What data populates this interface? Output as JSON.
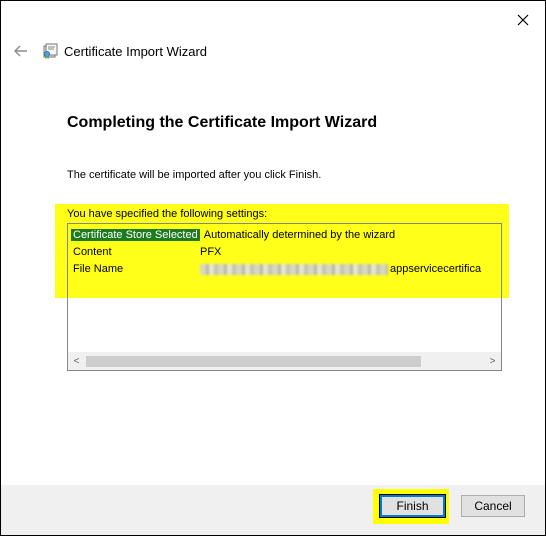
{
  "window": {
    "title": "Certificate Import Wizard"
  },
  "page": {
    "heading": "Completing the Certificate Import Wizard",
    "info_text": "The certificate will be imported after you click Finish.",
    "settings_label": "You have specified the following settings:"
  },
  "settings": {
    "rows": [
      {
        "key": "Certificate Store Selected",
        "value": "Automatically determined by the wizard"
      },
      {
        "key": "Content",
        "value": "PFX"
      },
      {
        "key": "File Name",
        "value": "appservicecertifica"
      }
    ]
  },
  "buttons": {
    "finish": "Finish",
    "cancel": "Cancel"
  },
  "scroll": {
    "left_arrow": "<",
    "right_arrow": ">"
  },
  "colors": {
    "highlight": "#ffff00",
    "selection": "#1e7a20",
    "focus_border": "#0078d7",
    "footer_bg": "#f0f0f0"
  },
  "icons": {
    "close": "close-icon",
    "back": "back-arrow-icon",
    "app": "certificate-icon"
  }
}
